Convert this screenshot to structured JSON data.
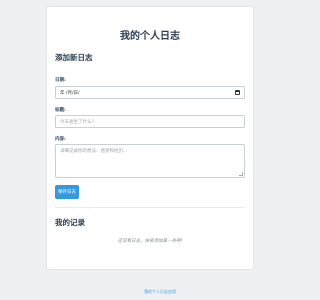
{
  "header": {
    "title": "我的个人日志"
  },
  "form": {
    "section_title": "添加新日志",
    "date": {
      "label": "日期:",
      "value": "年 /月/日/"
    },
    "title": {
      "label": "标题:",
      "placeholder": "今天发生了什么?"
    },
    "content": {
      "label": "内容:",
      "placeholder": "详细记录你的想法、感受和经历..."
    },
    "save_label": "保存日志"
  },
  "records": {
    "section_title": "我的记录",
    "empty_message": "还没有日志，快来添加第一条吧!"
  },
  "footer": {
    "text": "我的个人日志应用"
  },
  "colors": {
    "accent": "#3498db",
    "heading": "#2c3e50",
    "background": "#eef0f3"
  },
  "icons": {
    "date_picker": "calendar-icon"
  }
}
